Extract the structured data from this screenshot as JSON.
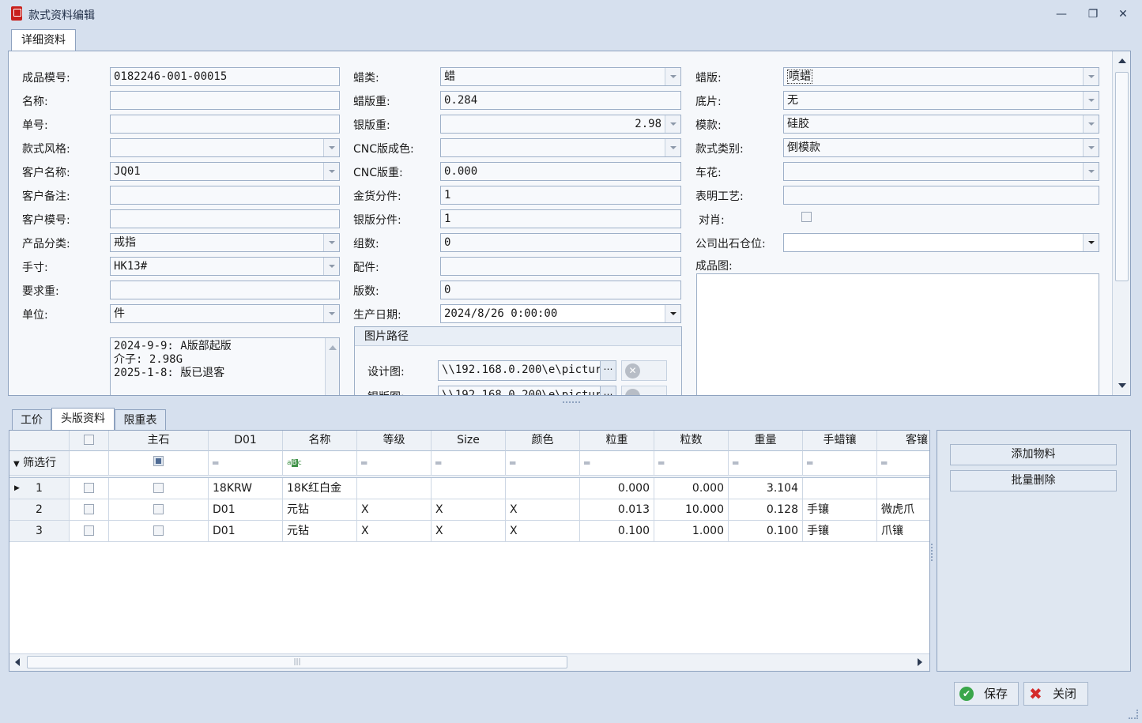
{
  "window": {
    "title": "款式资料编辑"
  },
  "top_tabs": [
    "详细资料"
  ],
  "col1": {
    "fields": [
      {
        "label": "成品模号:",
        "value": "0182246-001-00015",
        "dropdown": false
      },
      {
        "label": "名称:",
        "value": "",
        "dropdown": false
      },
      {
        "label": "单号:",
        "value": "",
        "dropdown": false
      },
      {
        "label": "款式风格:",
        "value": "",
        "dropdown": true
      },
      {
        "label": "客户名称:",
        "value": "JQ01",
        "dropdown": true
      },
      {
        "label": "客户备注:",
        "value": "",
        "dropdown": false
      },
      {
        "label": "客户模号:",
        "value": "",
        "dropdown": false
      },
      {
        "label": "产品分类:",
        "value": "戒指",
        "dropdown": true
      },
      {
        "label": "手寸:",
        "value": "HK13#",
        "dropdown": true
      },
      {
        "label": "要求重:",
        "value": "",
        "dropdown": false
      },
      {
        "label": "单位:",
        "value": "件",
        "dropdown": true
      }
    ],
    "memo": "2024-9-9: A版部起版\n介子: 2.98G\n2025-1-8: 版已退客"
  },
  "col2": {
    "fields": [
      {
        "label": "蜡类:",
        "value": "蜡",
        "dropdown": true
      },
      {
        "label": "蜡版重:",
        "value": "0.284",
        "dropdown": false
      },
      {
        "label": "银版重:",
        "value": "2.98",
        "dropdown": true
      },
      {
        "label": "CNC版成色:",
        "value": "",
        "dropdown": true
      },
      {
        "label": "CNC版重:",
        "value": "0.000",
        "dropdown": false
      },
      {
        "label": "金货分件:",
        "value": "1",
        "dropdown": false
      },
      {
        "label": "银版分件:",
        "value": "1",
        "dropdown": false
      },
      {
        "label": "组数:",
        "value": "0",
        "dropdown": false
      },
      {
        "label": "配件:",
        "value": "",
        "dropdown": false
      },
      {
        "label": "版数:",
        "value": "0",
        "dropdown": false
      },
      {
        "label": "生产日期:",
        "value": "2024/8/26 0:00:00",
        "dropdown": true
      }
    ],
    "image_group": {
      "title": "图片路径",
      "design_label": "设计图:",
      "design_path": "\\\\192.168.0.200\\e\\pictur...",
      "second_label": "银版图:",
      "second_path": "\\\\192.168.0.200\\e\\pictur..."
    }
  },
  "col3": {
    "fields": [
      {
        "label": "蜡版:",
        "value": "喷蜡",
        "dropdown": true
      },
      {
        "label": "底片:",
        "value": "无",
        "dropdown": true
      },
      {
        "label": "模款:",
        "value": "硅胶",
        "dropdown": true
      },
      {
        "label": "款式类别:",
        "value": "倒模款",
        "dropdown": true
      },
      {
        "label": "车花:",
        "value": "",
        "dropdown": true
      },
      {
        "label": "表明工艺:",
        "value": "",
        "dropdown": false
      }
    ],
    "check_label": "对肖:",
    "warehouse_label": "公司出石仓位:",
    "warehouse_value": "",
    "image_label": "成品图:"
  },
  "bottom_tabs": [
    "工价",
    "头版资料",
    "限重表"
  ],
  "grid": {
    "headers": [
      "主石",
      "D01",
      "名称",
      "等级",
      "Size",
      "颜色",
      "粒重",
      "粒数",
      "重量",
      "手蜡镶",
      "客镶"
    ],
    "filter_label": "筛选行",
    "rows": [
      {
        "num": "1",
        "d01": "18KRW",
        "name": "18K红白金",
        "grade": "",
        "size": "",
        "color": "",
        "unit_wt": "0.000",
        "count": "0.000",
        "weight": "3.104",
        "hand": "",
        "set": ""
      },
      {
        "num": "2",
        "d01": "D01",
        "name": "元钻",
        "grade": "X",
        "size": "X",
        "color": "X",
        "unit_wt": "0.013",
        "count": "10.000",
        "weight": "0.128",
        "hand": "手镶",
        "set": "微虎爪"
      },
      {
        "num": "3",
        "d01": "D01",
        "name": "元钻",
        "grade": "X",
        "size": "X",
        "color": "X",
        "unit_wt": "0.100",
        "count": "1.000",
        "weight": "0.100",
        "hand": "手镶",
        "set": "爪镶"
      }
    ]
  },
  "side_buttons": {
    "add": "添加物料",
    "delete": "批量删除"
  },
  "footer": {
    "save": "保存",
    "close": "关闭"
  },
  "colors": {
    "accent": "#8ea2bf",
    "background": "#d6e0ee",
    "save_icon": "#3aa64a",
    "close_icon": "#d42b2b"
  }
}
